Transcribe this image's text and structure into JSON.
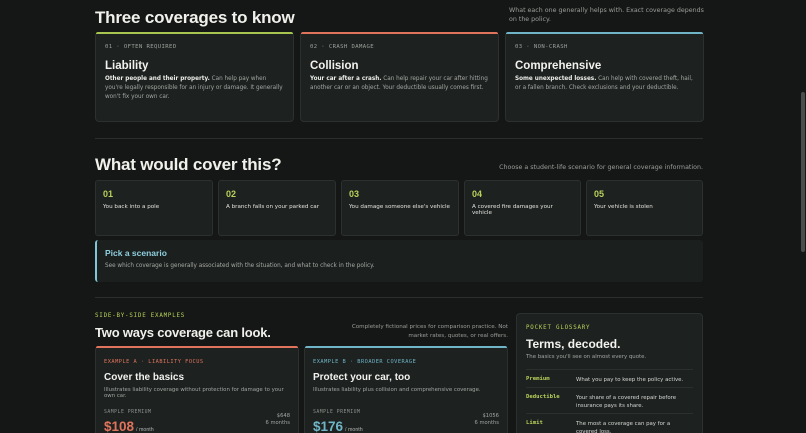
{
  "coverages": {
    "title": "Three coverages to know",
    "note": "What each one generally helps with. Exact coverage depends on the policy.",
    "cards": [
      {
        "tag": "01 · OFTEN REQUIRED",
        "title": "Liability",
        "lead": "Other people and their property.",
        "desc": " Can help pay when you're legally responsible for an injury or damage. It generally won't fix your own car.",
        "accent": "#a8c64f"
      },
      {
        "tag": "02 · CRASH DAMAGE",
        "title": "Collision",
        "lead": "Your car after a crash.",
        "desc": " Can help repair your car after hitting another car or an object. Your deductible usually comes first.",
        "accent": "#e0735c"
      },
      {
        "tag": "03 · NON-CRASH",
        "title": "Comprehensive",
        "lead": "Some unexpected losses.",
        "desc": " Can help with covered theft, hail, or a fallen branch. Check exclusions and your deductible.",
        "accent": "#6fb5c7"
      }
    ]
  },
  "scenarios": {
    "title": "What would cover this?",
    "note": "Choose a student-life scenario for general coverage information.",
    "items": [
      {
        "num": "01",
        "text": "You back into a pole"
      },
      {
        "num": "02",
        "text": "A branch falls on your parked car"
      },
      {
        "num": "03",
        "text": "You damage someone else's vehicle"
      },
      {
        "num": "04",
        "text": "A covered fire damages your vehicle"
      },
      {
        "num": "05",
        "text": "Your vehicle is stolen"
      }
    ],
    "pick_title": "Pick a scenario",
    "pick_desc": "See which coverage is generally associated with the situation, and what to check in the policy."
  },
  "examples": {
    "eyebrow": "SIDE-BY-SIDE EXAMPLES",
    "title": "Two ways coverage can look.",
    "note": "Completely fictional prices for comparison practice. Not market rates, quotes, or real offers.",
    "cards": [
      {
        "tag": "EXAMPLE A · LIABILITY FOCUS",
        "title": "Cover the basics",
        "desc": "Illustrates liability coverage without protection for damage to your own car.",
        "sp_label": "SAMPLE PREMIUM",
        "price": "$108",
        "per": "/ month",
        "total": "$648",
        "term": "6 months",
        "accent": "#e0735c"
      },
      {
        "tag": "EXAMPLE B · BROADER COVERAGE",
        "title": "Protect your car, too",
        "desc": "Illustrates liability plus collision and comprehensive coverage.",
        "sp_label": "SAMPLE PREMIUM",
        "price": "$176",
        "per": "/ month",
        "total": "$1056",
        "term": "6 months",
        "accent": "#6fb5c7"
      }
    ]
  },
  "glossary": {
    "eyebrow": "POCKET GLOSSARY",
    "title": "Terms, decoded.",
    "subtitle": "The basics you'll see on almost every quote.",
    "terms": [
      {
        "term": "Premium",
        "def": "What you pay to keep the policy active."
      },
      {
        "term": "Deductible",
        "def": "Your share of a covered repair before insurance pays its share."
      },
      {
        "term": "Limit",
        "def": "The most a coverage can pay for a covered loss."
      }
    ]
  }
}
